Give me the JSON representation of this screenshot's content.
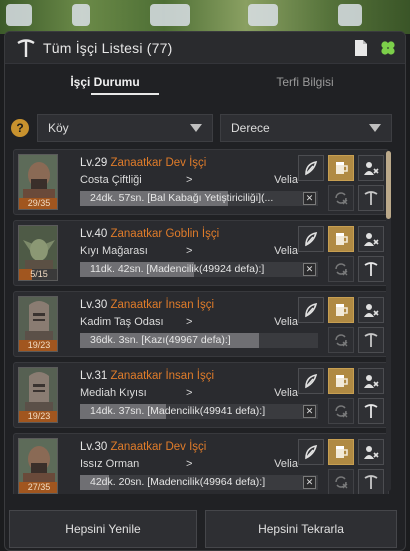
{
  "window": {
    "title": "Tüm İşçi Listesi (77)",
    "icons": [
      "document-icon",
      "clover-icon"
    ]
  },
  "tabs": [
    {
      "label": "İşçi Durumu",
      "active": true
    },
    {
      "label": "Terfi Bilgisi",
      "active": false
    }
  ],
  "filters": {
    "help": "?",
    "location": "Köy",
    "sort": "Derece"
  },
  "workers": [
    {
      "level": "Lv.29",
      "job": "Zanaatkar Dev İşçi",
      "place": "Costa Çiftliği",
      "arrow": ">",
      "town": "Velia",
      "stamina": "29/35",
      "task": "24dk. 57sn. [Bal Kabağı Yetiştiriciliği](...",
      "progress": 0.62,
      "portrait": "giant"
    },
    {
      "level": "Lv.40",
      "job": "Zanaatkar Goblin İşçi",
      "place": "Kıyı Mağarası",
      "arrow": ">",
      "town": "Velia",
      "stamina": "5/15",
      "task": "11dk. 42sn. [Madencilik(49924 defa):]",
      "progress": 0.48,
      "portrait": "goblin"
    },
    {
      "level": "Lv.30",
      "job": "Zanaatkar İnsan İşçi",
      "place": "Kadim Taş Odası",
      "arrow": ">",
      "town": "Velia",
      "stamina": "19/23",
      "task": "36dk. 3sn. [Kazı(49967 defa):]",
      "progress": 0.75,
      "portrait": "human"
    },
    {
      "level": "Lv.31",
      "job": "Zanaatkar İnsan İşçi",
      "place": "Mediah Kıyısı",
      "arrow": ">",
      "town": "Velia",
      "stamina": "19/23",
      "task": "14dk. 37sn. [Madencilik(49941 defa):]",
      "progress": 0.36,
      "portrait": "human"
    },
    {
      "level": "Lv.30",
      "job": "Zanaatkar Dev İşçi",
      "place": "Issız Orman",
      "arrow": ">",
      "town": "Velia",
      "stamina": "27/35",
      "task": "42dk. 20sn. [Madencilik(49964 defa):]",
      "progress": 0.12,
      "portrait": "giant"
    }
  ],
  "footer": {
    "refresh_all": "Hepsini Yenile",
    "repeat_all": "Hepsini Tekrarla"
  },
  "colors": {
    "job": "#e07c2a",
    "accent_gold": "#b08a43",
    "stamina": "#a1561f"
  }
}
